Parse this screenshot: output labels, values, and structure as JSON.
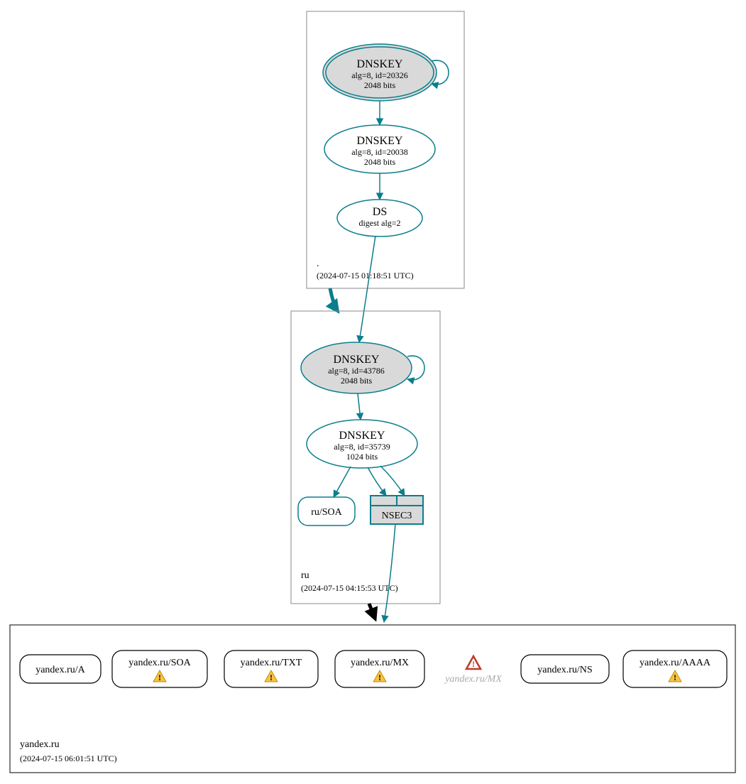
{
  "zones": {
    "root": {
      "label": ".",
      "timestamp": "(2024-07-15 01:18:51 UTC)",
      "ksk": {
        "title": "DNSKEY",
        "line1": "alg=8, id=20326",
        "line2": "2048 bits"
      },
      "zsk": {
        "title": "DNSKEY",
        "line1": "alg=8, id=20038",
        "line2": "2048 bits"
      },
      "ds": {
        "title": "DS",
        "line1": "digest alg=2"
      }
    },
    "ru": {
      "label": "ru",
      "timestamp": "(2024-07-15 04:15:53 UTC)",
      "ksk": {
        "title": "DNSKEY",
        "line1": "alg=8, id=43786",
        "line2": "2048 bits"
      },
      "zsk": {
        "title": "DNSKEY",
        "line1": "alg=8, id=35739",
        "line2": "1024 bits"
      },
      "soa": "ru/SOA",
      "nsec3": "NSEC3"
    },
    "yandex": {
      "label": "yandex.ru",
      "timestamp": "(2024-07-15 06:01:51 UTC)",
      "rrsets": {
        "a": "yandex.ru/A",
        "soa": "yandex.ru/SOA",
        "txt": "yandex.ru/TXT",
        "mx": "yandex.ru/MX",
        "ns": "yandex.ru/NS",
        "aaaa": "yandex.ru/AAAA",
        "mx_ghost": "yandex.ru/MX"
      }
    }
  }
}
